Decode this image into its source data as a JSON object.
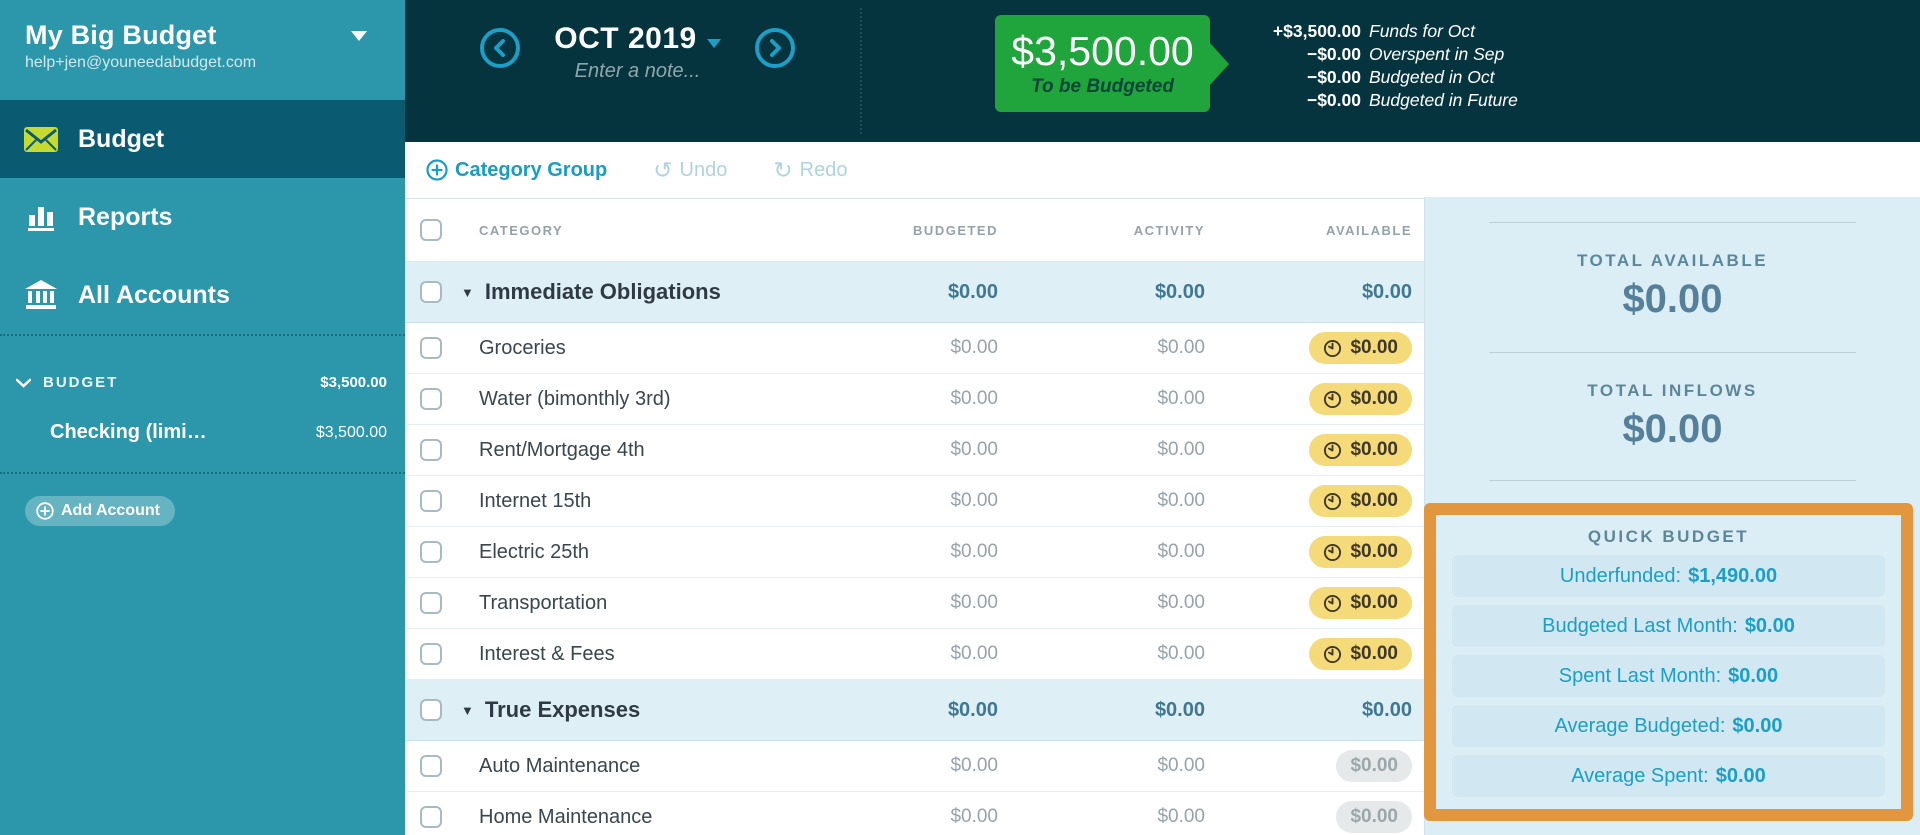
{
  "colors": {
    "sidebar_teal": "#2C96AA",
    "sidebar_active": "#0A5B72",
    "header_dark": "#05343F",
    "accent_blue": "#189DC4",
    "tbb_green": "#1FA53C",
    "warning_yellow": "#F5DA7A",
    "highlight_orange": "#E2973F",
    "panel_blue": "#DCEEF5"
  },
  "icons": {
    "undo": "↺",
    "redo": "↻",
    "group_triangle": "▼"
  },
  "sidebar": {
    "budget_name": "My Big Budget",
    "email": "help+jen@youneedabudget.com",
    "nav": [
      {
        "label": "Budget"
      },
      {
        "label": "Reports"
      },
      {
        "label": "All Accounts"
      }
    ],
    "accounts_section": {
      "label": "BUDGET",
      "total": "$3,500.00",
      "accounts": [
        {
          "name": "Checking (limi…",
          "balance": "$3,500.00"
        }
      ]
    },
    "add_account_label": "Add Account"
  },
  "header": {
    "month": "OCT 2019",
    "note_placeholder": "Enter a note...",
    "to_be_budgeted": {
      "amount": "$3,500.00",
      "label": "To be Budgeted"
    },
    "breakdown": [
      {
        "amount": "+$3,500.00",
        "label": "Funds for Oct"
      },
      {
        "amount": "−$0.00",
        "label": "Overspent in Sep"
      },
      {
        "amount": "−$0.00",
        "label": "Budgeted in Oct"
      },
      {
        "amount": "−$0.00",
        "label": "Budgeted in Future"
      }
    ]
  },
  "toolbar": {
    "category_group": "Category Group",
    "undo": "Undo",
    "redo": "Redo"
  },
  "table": {
    "columns": [
      "CATEGORY",
      "BUDGETED",
      "ACTIVITY",
      "AVAILABLE"
    ],
    "rows": [
      {
        "type": "group",
        "name": "Immediate Obligations",
        "budgeted": "$0.00",
        "activity": "$0.00",
        "available": "$0.00"
      },
      {
        "type": "category",
        "name": "Groceries",
        "budgeted": "$0.00",
        "activity": "$0.00",
        "available": "$0.00"
      },
      {
        "type": "category",
        "name": "Water (bimonthly 3rd)",
        "budgeted": "$0.00",
        "activity": "$0.00",
        "available": "$0.00"
      },
      {
        "type": "category",
        "name": "Rent/Mortgage 4th",
        "budgeted": "$0.00",
        "activity": "$0.00",
        "available": "$0.00"
      },
      {
        "type": "category",
        "name": "Internet 15th",
        "budgeted": "$0.00",
        "activity": "$0.00",
        "available": "$0.00"
      },
      {
        "type": "category",
        "name": "Electric 25th",
        "budgeted": "$0.00",
        "activity": "$0.00",
        "available": "$0.00"
      },
      {
        "type": "category",
        "name": "Transportation",
        "budgeted": "$0.00",
        "activity": "$0.00",
        "available": "$0.00"
      },
      {
        "type": "category",
        "name": "Interest & Fees",
        "budgeted": "$0.00",
        "activity": "$0.00",
        "available": "$0.00"
      },
      {
        "type": "group",
        "name": "True Expenses",
        "budgeted": "$0.00",
        "activity": "$0.00",
        "available": "$0.00"
      },
      {
        "type": "category",
        "name": "Auto Maintenance",
        "budgeted": "$0.00",
        "activity": "$0.00",
        "available": "$0.00"
      },
      {
        "type": "category",
        "name": "Home Maintenance",
        "budgeted": "$0.00",
        "activity": "$0.00",
        "available": "$0.00"
      }
    ]
  },
  "inspector": {
    "total_available": {
      "label": "TOTAL AVAILABLE",
      "amount": "$0.00"
    },
    "total_inflows": {
      "label": "TOTAL INFLOWS",
      "amount": "$0.00"
    },
    "quick_budget": {
      "title": "QUICK BUDGET",
      "options": [
        {
          "label": "Underfunded:",
          "value": "$1,490.00"
        },
        {
          "label": "Budgeted Last Month:",
          "value": "$0.00"
        },
        {
          "label": "Spent Last Month:",
          "value": "$0.00"
        },
        {
          "label": "Average Budgeted:",
          "value": "$0.00"
        },
        {
          "label": "Average Spent:",
          "value": "$0.00"
        }
      ]
    }
  }
}
